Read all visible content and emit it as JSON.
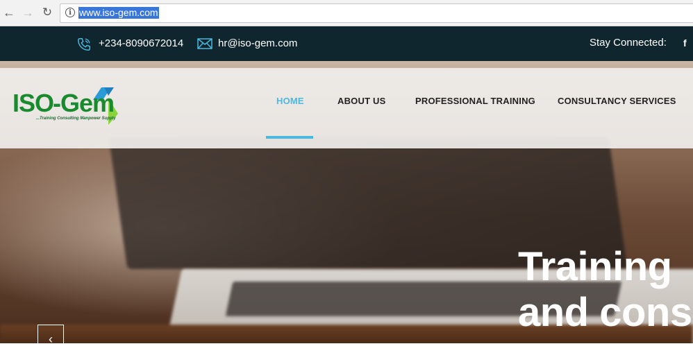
{
  "browser": {
    "url": "www.iso-gem.com",
    "back_icon": "arrow-left-icon",
    "forward_icon": "arrow-right-icon",
    "reload_icon": "reload-icon",
    "info_icon": "info-icon"
  },
  "topbar": {
    "phone": "+234-8090672014",
    "email": "hr@iso-gem.com",
    "stay_connected": "Stay Connected:",
    "social_icon": "facebook-icon",
    "background": "#10262f"
  },
  "logo": {
    "name_part1": "ISO",
    "name_part2": "-Gem",
    "tagline": "...Training Consulting Manpower Supply"
  },
  "menu": {
    "items": [
      {
        "label": "HOME",
        "active": true
      },
      {
        "label": "ABOUT US",
        "active": false
      },
      {
        "label": "PROFESSIONAL TRAINING",
        "active": false
      },
      {
        "label": "CONSULTANCY SERVICES",
        "active": false
      }
    ],
    "accent": "#4bb8de"
  },
  "hero": {
    "line1": "Training",
    "line2": "and cons",
    "prev_icon": "chevron-left-icon"
  }
}
